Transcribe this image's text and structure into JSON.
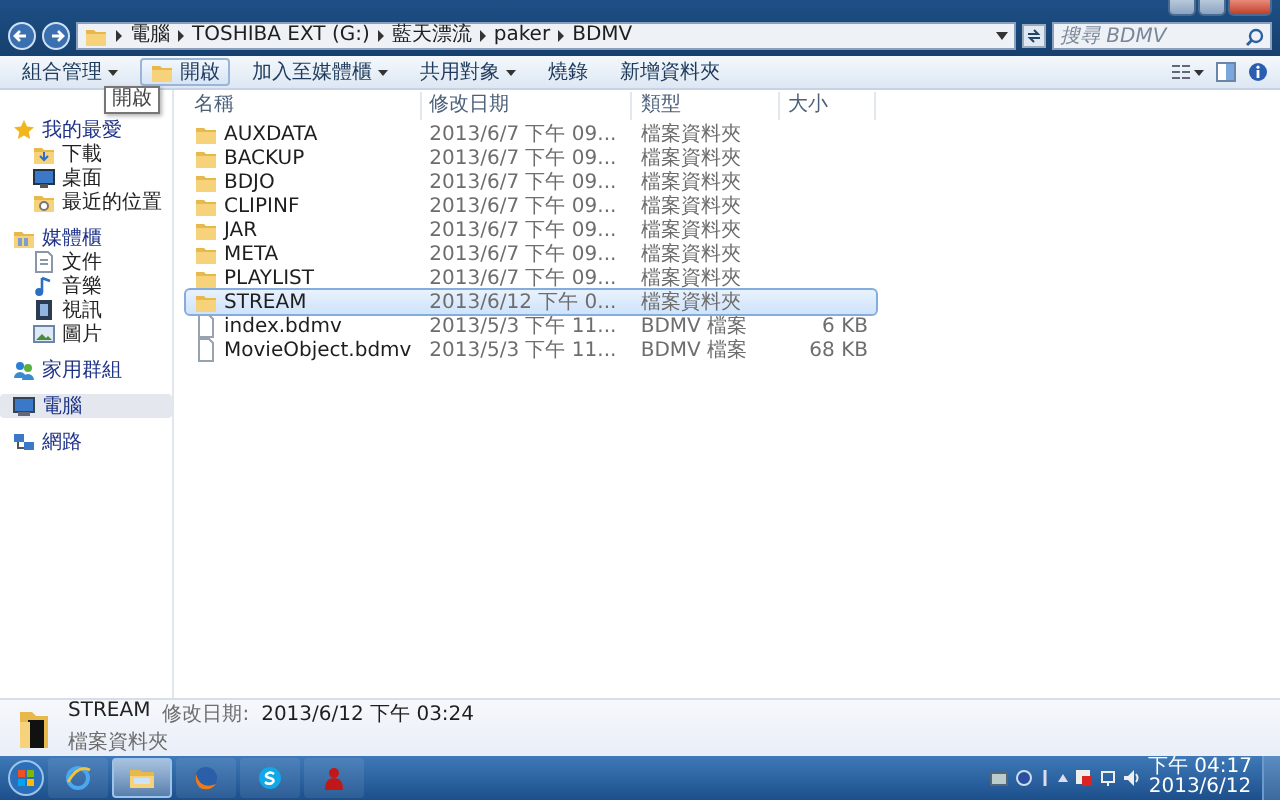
{
  "address_bar": {
    "breadcrumbs": [
      "電腦",
      "TOSHIBA EXT (G:)",
      "藍天漂流",
      "paker",
      "BDMV"
    ]
  },
  "search": {
    "placeholder": "搜尋 BDMV"
  },
  "toolbar": [
    {
      "label": "組合管理",
      "dropdown": true
    },
    {
      "label": "開啟",
      "dropdown": false
    },
    {
      "label": "加入至媒體櫃",
      "dropdown": true
    },
    {
      "label": "共用對象",
      "dropdown": true
    },
    {
      "label": "燒錄",
      "dropdown": false
    },
    {
      "label": "新增資料夾",
      "dropdown": false
    }
  ],
  "tooltip": "開啟",
  "sidebar": [
    {
      "label": "我的最愛",
      "selected": false,
      "children": [
        {
          "label": "下載",
          "selected": false
        },
        {
          "label": "桌面",
          "selected": false
        },
        {
          "label": "最近的位置",
          "selected": false
        }
      ]
    },
    {
      "label": "媒體櫃",
      "selected": false,
      "children": [
        {
          "label": "文件",
          "selected": false
        },
        {
          "label": "音樂",
          "selected": false
        },
        {
          "label": "視訊",
          "selected": false
        },
        {
          "label": "圖片",
          "selected": false
        }
      ]
    },
    {
      "label": "家用群組",
      "selected": false
    },
    {
      "label": "電腦",
      "selected": true
    },
    {
      "label": "網路",
      "selected": false
    }
  ],
  "columns": [
    "名稱",
    "修改日期",
    "類型",
    "大小"
  ],
  "rows": [
    {
      "kind": "folder",
      "name": "AUXDATA",
      "modified": "2013/6/7 下午 09...",
      "type": "檔案資料夾",
      "selected": false
    },
    {
      "kind": "folder",
      "name": "BACKUP",
      "modified": "2013/6/7 下午 09...",
      "type": "檔案資料夾",
      "selected": false
    },
    {
      "kind": "folder",
      "name": "BDJO",
      "modified": "2013/6/7 下午 09...",
      "type": "檔案資料夾",
      "selected": false
    },
    {
      "kind": "folder",
      "name": "CLIPINF",
      "modified": "2013/6/7 下午 09...",
      "type": "檔案資料夾",
      "selected": false
    },
    {
      "kind": "folder",
      "name": "JAR",
      "modified": "2013/6/7 下午 09...",
      "type": "檔案資料夾",
      "selected": false
    },
    {
      "kind": "folder",
      "name": "META",
      "modified": "2013/6/7 下午 09...",
      "type": "檔案資料夾",
      "selected": false
    },
    {
      "kind": "folder",
      "name": "PLAYLIST",
      "modified": "2013/6/7 下午 09...",
      "type": "檔案資料夾",
      "selected": false
    },
    {
      "kind": "folder",
      "name": "STREAM",
      "modified": "2013/6/12 下午 0...",
      "type": "檔案資料夾",
      "selected": true
    },
    {
      "kind": "file",
      "name": "index.bdmv",
      "modified": "2013/5/3 下午 11...",
      "type": "BDMV 檔案",
      "size": "6 KB",
      "selected": false
    },
    {
      "kind": "file",
      "name": "MovieObject.bdmv",
      "modified": "2013/5/3 下午 11...",
      "type": "BDMV 檔案",
      "size": "68 KB",
      "selected": false
    }
  ],
  "details": {
    "name": "STREAM",
    "modified_label": "修改日期:",
    "modified": "2013/6/12 下午 03:24",
    "type": "檔案資料夾"
  },
  "taskbar": {
    "apps": [
      {
        "kind": "browser",
        "selected": false
      },
      {
        "kind": "explorer",
        "selected": true
      },
      {
        "kind": "firefox",
        "selected": false
      },
      {
        "kind": "skype",
        "selected": false
      },
      {
        "kind": "person",
        "selected": false
      }
    ],
    "clock": {
      "time": "下午 04:17",
      "date": "2013/6/12"
    }
  }
}
